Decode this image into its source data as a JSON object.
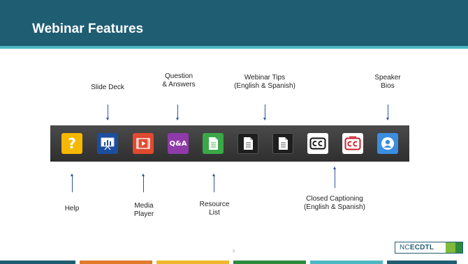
{
  "slide": {
    "title": "Webinar Features",
    "page_number": "3",
    "logo": {
      "prefix": "NC",
      "suffix": "ECDTL"
    }
  },
  "top_labels": [
    {
      "id": "slide-deck",
      "lines": [
        "Slide Deck"
      ]
    },
    {
      "id": "question-answers",
      "lines": [
        "Question",
        "& Answers"
      ]
    },
    {
      "id": "webinar-tips",
      "lines": [
        "Webinar Tips",
        "(English & Spanish)"
      ]
    },
    {
      "id": "speaker-bios",
      "lines": [
        "Speaker",
        "Bios"
      ]
    }
  ],
  "bottom_labels": [
    {
      "id": "help",
      "lines": [
        "Help"
      ]
    },
    {
      "id": "media-player",
      "lines": [
        "Media",
        "Player"
      ]
    },
    {
      "id": "resource-list",
      "lines": [
        "Resource",
        "List"
      ]
    },
    {
      "id": "closed-captioning",
      "lines": [
        "Closed Captioning",
        "(English & Spanish)"
      ]
    }
  ],
  "toolbar_icons": [
    {
      "name": "help-icon",
      "glyph": "?",
      "color": "#f5b800"
    },
    {
      "name": "slide-deck-icon",
      "color": "#1c4e9e"
    },
    {
      "name": "media-player-icon",
      "color": "#e04a2f"
    },
    {
      "name": "qa-icon",
      "glyph": "Q&A",
      "color": "#8e3aa8"
    },
    {
      "name": "resource-list-icon",
      "color": "#3aa848"
    },
    {
      "name": "webinar-tips-english-icon",
      "color": "#1e1e1e"
    },
    {
      "name": "webinar-tips-spanish-icon",
      "color": "#1e1e1e"
    },
    {
      "name": "closed-captioning-english-icon",
      "color": "#ffffff"
    },
    {
      "name": "closed-captioning-spanish-icon",
      "color": "#ffffff"
    },
    {
      "name": "speaker-bios-icon",
      "color": "#3b8de0"
    }
  ],
  "colors": {
    "title_bar": "#1f5d73",
    "accent_line": "#4cb8c4",
    "arrow": "#2f5597",
    "toolbar": "#3a3a3a",
    "footer": [
      "#1f5d73",
      "#e07b2a",
      "#f0b82e",
      "#2e8b3d",
      "#4cb8c4",
      "#1f5d73"
    ]
  }
}
